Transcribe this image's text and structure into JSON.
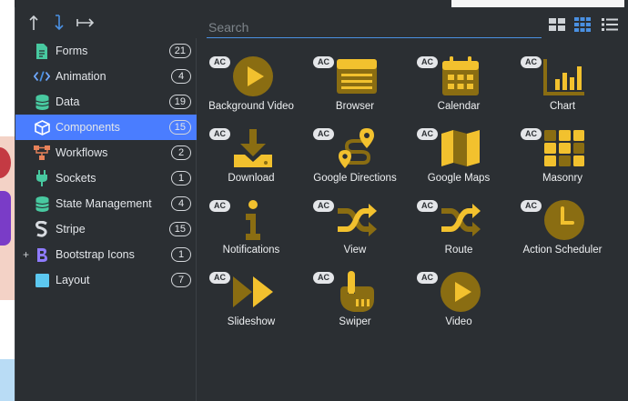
{
  "search": {
    "placeholder": "Search"
  },
  "sidebar": {
    "items": [
      {
        "label": "Forms",
        "count": "21",
        "icon": "file-icon",
        "color": "#48c9a0"
      },
      {
        "label": "Animation",
        "count": "4",
        "icon": "code-icon",
        "color": "#6fa8ff"
      },
      {
        "label": "Data",
        "count": "19",
        "icon": "database-icon",
        "color": "#48c9a0"
      },
      {
        "label": "Components",
        "count": "15",
        "icon": "cube-icon",
        "color": "#ffffff",
        "active": true
      },
      {
        "label": "Workflows",
        "count": "2",
        "icon": "workflow-icon",
        "color": "#e8825a"
      },
      {
        "label": "Sockets",
        "count": "1",
        "icon": "plug-icon",
        "color": "#48c9a0"
      },
      {
        "label": "State Management",
        "count": "4",
        "icon": "database-icon",
        "color": "#48c9a0"
      },
      {
        "label": "Stripe",
        "count": "15",
        "icon": "stripe-icon",
        "color": "#d8dbe0"
      },
      {
        "label": "Bootstrap Icons",
        "count": "1",
        "icon": "bootstrap-icon",
        "color": "#8f7bff",
        "expander": "+"
      },
      {
        "label": "Layout",
        "count": "7",
        "icon": "square-icon",
        "color": "#5cc8f0"
      }
    ]
  },
  "components": [
    {
      "badge": "AC",
      "label": "Background Video",
      "icon": "play-circle-icon"
    },
    {
      "badge": "AC",
      "label": "Browser",
      "icon": "browser-window-icon"
    },
    {
      "badge": "AC",
      "label": "Calendar",
      "icon": "calendar-icon"
    },
    {
      "badge": "AC",
      "label": "Chart",
      "icon": "bar-chart-icon"
    },
    {
      "badge": "AC",
      "label": "Download",
      "icon": "download-icon"
    },
    {
      "badge": "AC",
      "label": "Google Directions",
      "icon": "directions-icon"
    },
    {
      "badge": "AC",
      "label": "Google Maps",
      "icon": "map-icon"
    },
    {
      "badge": "AC",
      "label": "Masonry",
      "icon": "masonry-grid-icon"
    },
    {
      "badge": "AC",
      "label": "Notifications",
      "icon": "info-icon"
    },
    {
      "badge": "AC",
      "label": "View",
      "icon": "shuffle-icon"
    },
    {
      "badge": "AC",
      "label": "Route",
      "icon": "shuffle-icon"
    },
    {
      "badge": "AC",
      "label": "Action Scheduler",
      "icon": "clock-icon"
    },
    {
      "badge": "AC",
      "label": "Slideshow",
      "icon": "fast-forward-icon"
    },
    {
      "badge": "AC",
      "label": "Swiper",
      "icon": "pointing-hand-icon"
    },
    {
      "badge": "AC",
      "label": "Video",
      "icon": "play-circle-icon"
    }
  ],
  "colors": {
    "accent": "#4a7dff",
    "icon_gold": "#f2c12e",
    "icon_dark": "#8a6d12",
    "panel": "#2b2f33"
  }
}
